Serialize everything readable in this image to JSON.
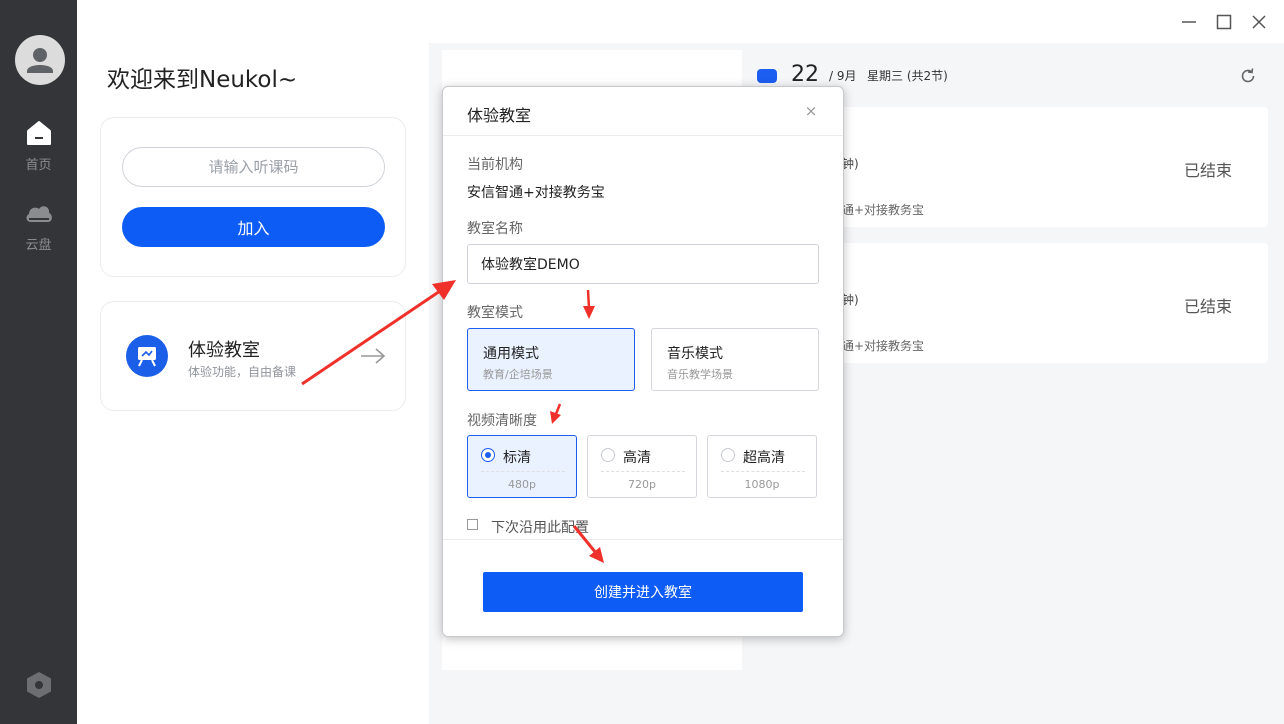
{
  "sidebar": {
    "items": [
      {
        "label": "首页",
        "icon": "home-icon"
      },
      {
        "label": "云盘",
        "icon": "cloud-icon"
      }
    ],
    "settings_icon": "hexagon-settings-icon"
  },
  "main": {
    "welcome": "欢迎来到Neukol~",
    "join": {
      "placeholder": "请输入听课码",
      "button_label": "加入"
    },
    "trial": {
      "title": "体验教室",
      "subtitle": "体验功能，自由备课"
    }
  },
  "schedule": {
    "day": "22",
    "month": "/ 9月",
    "weekday": "星期三 (共2节)",
    "items": [
      {
        "duration": "钟)",
        "org": "通+对接教务宝",
        "status": "已结束"
      },
      {
        "duration": "钟)",
        "org": "通+对接教务宝",
        "status": "已结束"
      }
    ]
  },
  "modal": {
    "title": "体验教室",
    "close_label": "×",
    "org_label": "当前机构",
    "org_value": "安信智通+对接教务宝",
    "name_label": "教室名称",
    "name_value": "体验教室DEMO",
    "mode_label": "教室模式",
    "modes": [
      {
        "name": "通用模式",
        "desc": "教育/企培场景",
        "selected": true
      },
      {
        "name": "音乐模式",
        "desc": "音乐教学场景",
        "selected": false
      }
    ],
    "quality_label": "视频清晰度",
    "qualities": [
      {
        "name": "标清",
        "res": "480p",
        "selected": true
      },
      {
        "name": "高清",
        "res": "720p",
        "selected": false
      },
      {
        "name": "超高清",
        "res": "1080p",
        "selected": false
      }
    ],
    "remember_label": "下次沿用此配置",
    "create_label": "创建并进入教室"
  },
  "colors": {
    "accent": "#0e5cf6",
    "sidebar_bg": "#333538",
    "panel_bg": "#f5f6f8",
    "annotation": "#f0302a"
  }
}
